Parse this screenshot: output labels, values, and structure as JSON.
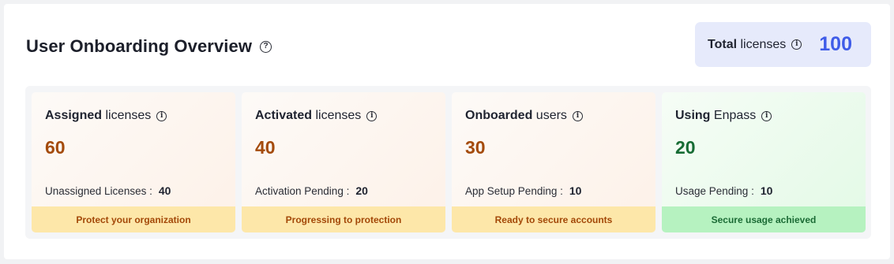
{
  "header": {
    "title": "User Onboarding Overview"
  },
  "total": {
    "label_bold": "Total",
    "label_rest": " licenses",
    "value": "100"
  },
  "cards": [
    {
      "title_bold": "Assigned",
      "title_rest": " licenses",
      "value": "60",
      "sub_label": "Unassigned Licenses :",
      "sub_value": "40",
      "footer": "Protect your organization"
    },
    {
      "title_bold": "Activated",
      "title_rest": " licenses",
      "value": "40",
      "sub_label": "Activation Pending :",
      "sub_value": "20",
      "footer": "Progressing to protection"
    },
    {
      "title_bold": "Onboarded",
      "title_rest": " users",
      "value": "30",
      "sub_label": "App Setup Pending :",
      "sub_value": "10",
      "footer": "Ready to secure accounts"
    },
    {
      "title_bold": "Using",
      "title_rest": " Enpass",
      "value": "20",
      "sub_label": "Usage Pending :",
      "sub_value": "10",
      "footer": "Secure usage achieved"
    }
  ],
  "icons": {
    "title_help": "question-circle-icon",
    "info": "info-circle-icon"
  },
  "colors": {
    "accent_blue": "#3f5ce8",
    "value_orange": "#a44b0c",
    "value_green": "#176c34",
    "footer_yellow": "#fde7a9",
    "footer_green": "#b6f2c0"
  }
}
